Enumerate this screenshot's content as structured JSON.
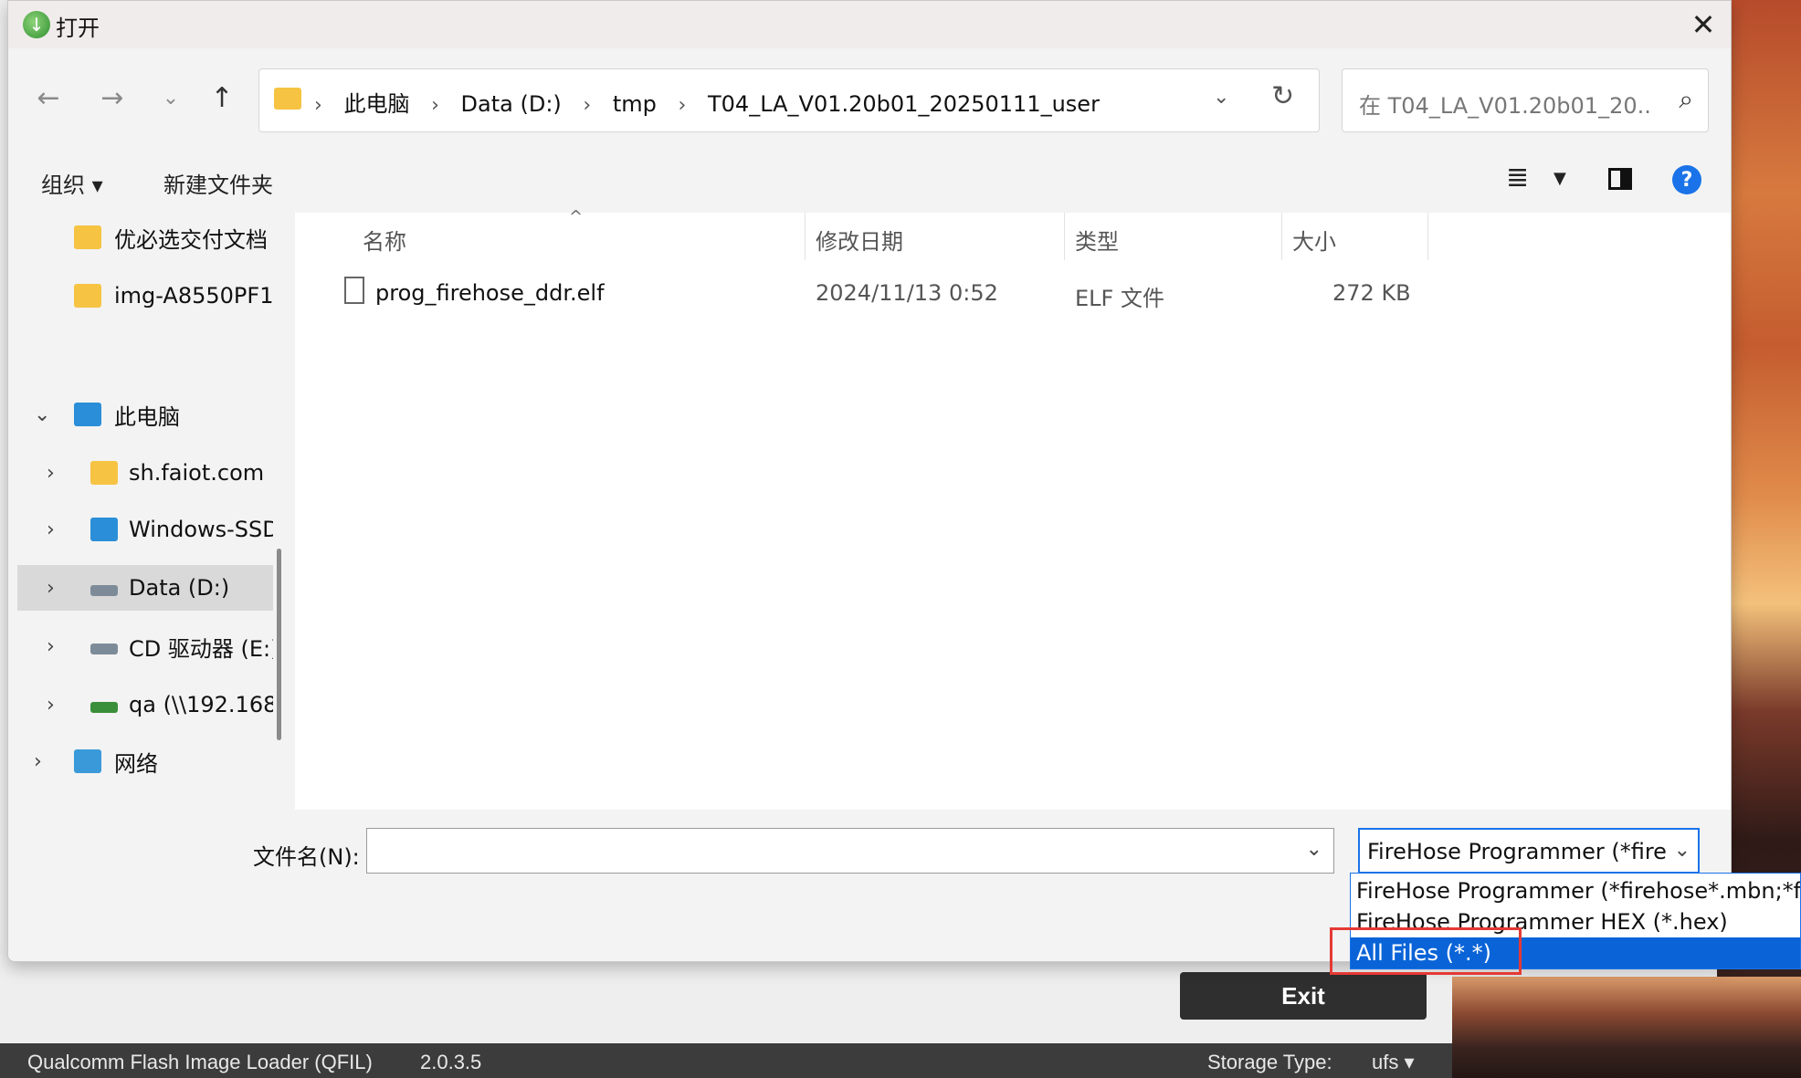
{
  "dialog": {
    "title": "打开",
    "close_label": "✕",
    "nav": {
      "back": "←",
      "forward": "→",
      "recent": "⌄",
      "up": "↑"
    },
    "address": {
      "crumbs": [
        "此电脑",
        "Data (D:)",
        "tmp",
        "T04_LA_V01.20b01_20250111_user"
      ],
      "separator": "›"
    },
    "search": {
      "placeholder": "在 T04_LA_V01.20b01_20..."
    },
    "toolbar": {
      "organize_label": "组织 ▾",
      "new_folder_label": "新建文件夹"
    },
    "navpane": {
      "items": [
        {
          "label": "优必选交付文档",
          "icon": "folder-icon"
        },
        {
          "label": "img-A8550PF1",
          "icon": "folder-icon"
        },
        {
          "label": "此电脑",
          "icon": "pc-icon",
          "expanded": true
        },
        {
          "label": "sh.faiot.com",
          "icon": "network-folder-icon"
        },
        {
          "label": "Windows-SSD",
          "icon": "windows-drive-icon"
        },
        {
          "label": "Data (D:)",
          "icon": "drive-icon",
          "selected": true
        },
        {
          "label": "CD 驱动器 (E:)",
          "icon": "cd-drive-icon"
        },
        {
          "label": "qa (\\\\192.168",
          "icon": "network-drive-icon"
        },
        {
          "label": "网络",
          "icon": "network-icon"
        }
      ]
    },
    "filelist": {
      "columns": [
        "名称",
        "修改日期",
        "类型",
        "大小"
      ],
      "rows": [
        {
          "name": "prog_firehose_ddr.elf",
          "modified": "2024/11/13 0:52",
          "type": "ELF 文件",
          "size": "272 KB"
        }
      ]
    },
    "filename": {
      "label": "文件名(N):",
      "value": ""
    },
    "filter": {
      "selected": "FireHose Programmer (*firehose*.mbn;*firehose*.elf)",
      "options": [
        "FireHose Programmer (*firehose*.mbn;*firehose*.elf)",
        "FireHose Programmer HEX (*.hex)",
        "All Files (*.*)"
      ],
      "highlighted_index": 2
    }
  },
  "qfil": {
    "exit_label": "Exit",
    "status": {
      "app_name": "Qualcomm Flash Image Loader (QFIL)",
      "version": "2.0.3.5",
      "storage_label": "Storage Type:",
      "storage_value": "ufs ▾"
    }
  },
  "colors": {
    "accent": "#1a73e8",
    "selection": "#0a64d8",
    "highlight_box": "#e53935"
  }
}
